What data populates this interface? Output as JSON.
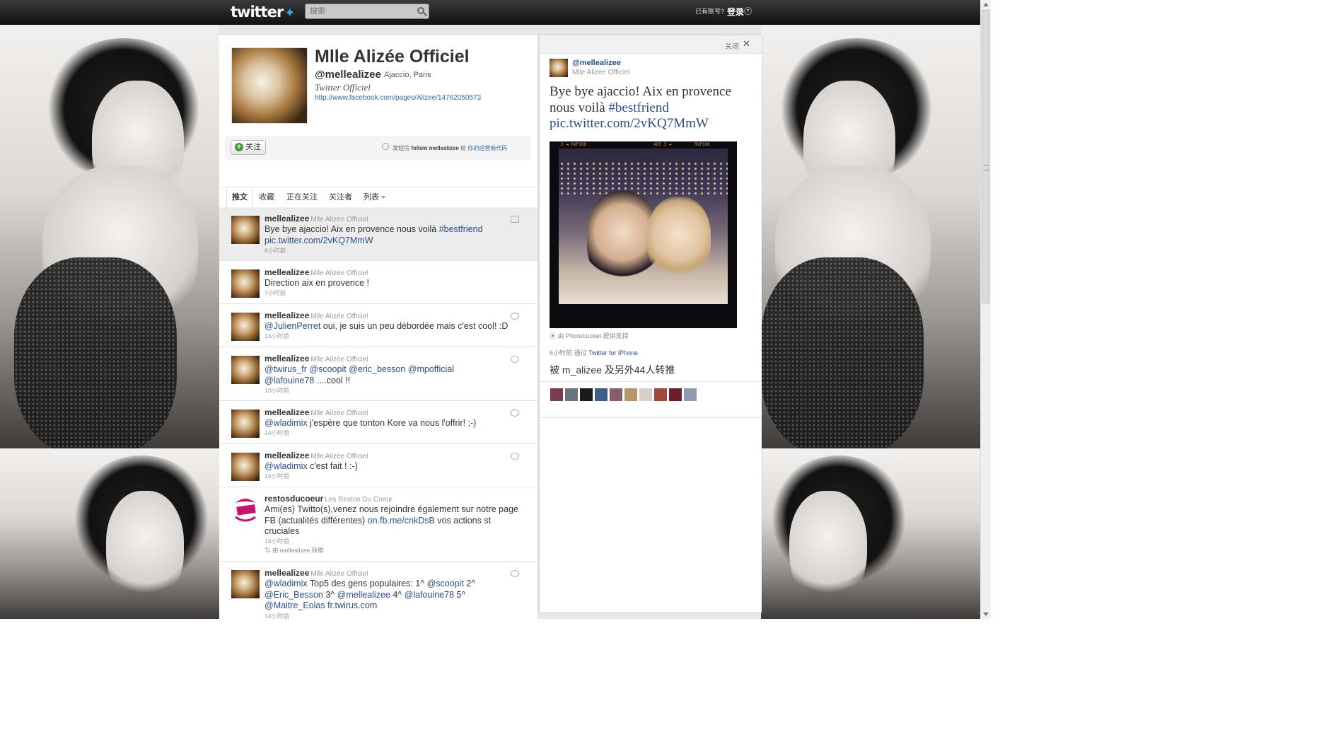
{
  "topbar": {
    "logo": "twitter",
    "search_placeholder": "搜索",
    "account_prompt": "已有账号?",
    "login_label": "登录"
  },
  "profile": {
    "name": "Mlle Alizée Officiel",
    "handle": "@mellealizee",
    "location": "Ajaccio, Paris",
    "bio": "Twitter Officiel",
    "url": "http://www.facebook.com/pages/Alizee/14762050573",
    "follow_label": "关注",
    "sms_prefix": "发短信",
    "sms_command": "follow mellealizee",
    "sms_middle": "给",
    "sms_code": "你的运营商代码"
  },
  "tabs": [
    "推文",
    "收藏",
    "正在关注",
    "关注者",
    "列表"
  ],
  "tweets": [
    {
      "user": "mellealizee",
      "name": "Mlle Alizée Officiel",
      "text_plain": "Bye bye ajaccio! Aix en provence nous voilà ",
      "link1": "#bestfriend",
      "link2": "pic.twitter.com/2vKQ7MmW",
      "time": "6小时前"
    },
    {
      "user": "mellealizee",
      "name": "Mlle Alizée Officiel",
      "text": "Direction aix en provence !",
      "time": "7小时前"
    },
    {
      "user": "mellealizee",
      "name": "Mlle Alizée Officiel",
      "mention": "@JulienPerret",
      "text": " oui, je suis un peu débordée mais c'est cool! :D",
      "time": "13小时前"
    },
    {
      "user": "mellealizee",
      "name": "Mlle Alizée Officiel",
      "m1": "@twirus_fr",
      "m2": "@scoopit",
      "m3": "@eric_besson",
      "m4": "@mpofficial",
      "m5": "@lafouine78",
      "text": " ....cool !!",
      "time": "13小时前"
    },
    {
      "user": "mellealizee",
      "name": "Mlle Alizée Officiel",
      "mention": "@wladimix",
      "text": " j'espère que tonton Kore va nous l'offrir! ;-)",
      "time": "14小时前"
    },
    {
      "user": "mellealizee",
      "name": "Mlle Alizée Officiel",
      "mention": "@wladimix",
      "text": " c'est fait ! :-)",
      "time": "14小时前"
    },
    {
      "user": "restosducoeur",
      "name": "Les Restos Du Coeur",
      "text": "Ami(es) Twitto(s),venez nous rejoindre également sur notre page FB (actualités différentes) ",
      "link": "on.fb.me/cnkDsB",
      "text_end": " vos actions st cruciales",
      "time": "14小时前",
      "retweeted_by": "由 mellealizee 转推"
    },
    {
      "user": "mellealizee",
      "name": "Mlle Alizée Officiel",
      "m1": "@wladimix",
      "t1": " Top5 des gens populaires: 1^ ",
      "m2": "@scoopit",
      "t2": " 2^ ",
      "m3": "@Eric_Besson",
      "t3": " 3^ ",
      "m4": "@mellealizee",
      "t4": " 4^ ",
      "m5": "@lafouine78",
      "t5": " 5^ ",
      "m6": "@Maitre_Eolas",
      "link": "fr.twirus.com",
      "time": "14小时前"
    }
  ],
  "detail": {
    "close_label": "关闭",
    "handle": "@mellealizee",
    "name": "Mlle Alizée Officiel",
    "text_plain": "Bye bye ajaccio! Aix en provence nous voilà ",
    "hashtag": "#bestfriend",
    "pic_link": "pic.twitter.com/2vKQ7MmW",
    "film_left": "2 ◄ RVP100",
    "film_mid": "465  3 ◄",
    "film_right": "RVP100",
    "credit": "由 Photobucket 提供支持",
    "meta_time": "6小时前 通过",
    "meta_client": "Twitter for iPhone",
    "retweet_line": "被 m_alizee 及另外44人转推"
  },
  "colors": {
    "link": "#2a4d8c",
    "topbar": "#1c1c1c",
    "follow_green": "#3a9d34"
  }
}
